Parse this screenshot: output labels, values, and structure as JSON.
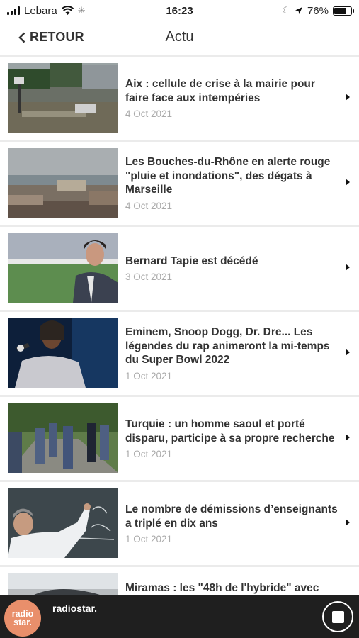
{
  "status_bar": {
    "carrier": "Lebara",
    "time": "16:23",
    "battery": "76%",
    "battery_level": 0.76
  },
  "nav": {
    "back_label": "RETOUR",
    "title": "Actu"
  },
  "articles": [
    {
      "title": "Aix : cellule de crise à la mairie pour faire face aux intempéries",
      "date": "4 Oct 2021",
      "thumb_icon": "flooded-street-photo"
    },
    {
      "title": "Les Bouches-du-Rhône en alerte rouge \"pluie et inondations\", des dégats à Marseille",
      "date": "4 Oct 2021",
      "thumb_icon": "marseille-harbor-photo"
    },
    {
      "title": "Bernard Tapie est décédé",
      "date": "3 Oct 2021",
      "thumb_icon": "man-in-suit-stadium-photo"
    },
    {
      "title": "Eminem, Snoop Dogg, Dr. Dre... Les légendes du rap animeront la mi-temps du Super Bowl 2022",
      "date": "1 Oct 2021",
      "thumb_icon": "rapper-microphone-photo"
    },
    {
      "title": "Turquie : un homme saoul et porté disparu, participe à sa propre recherche",
      "date": "1 Oct 2021",
      "thumb_icon": "search-party-photo"
    },
    {
      "title": "Le nombre de démissions d’enseignants a triplé en dix ans",
      "date": "1 Oct 2021",
      "thumb_icon": "teacher-blackboard-photo"
    },
    {
      "title": "Miramas : les \"48h de l'hybride\" avec",
      "date": "",
      "thumb_icon": "car-photo"
    }
  ],
  "player": {
    "logo_line1": "radio",
    "logo_line2": "star.",
    "station": "radiostar."
  }
}
